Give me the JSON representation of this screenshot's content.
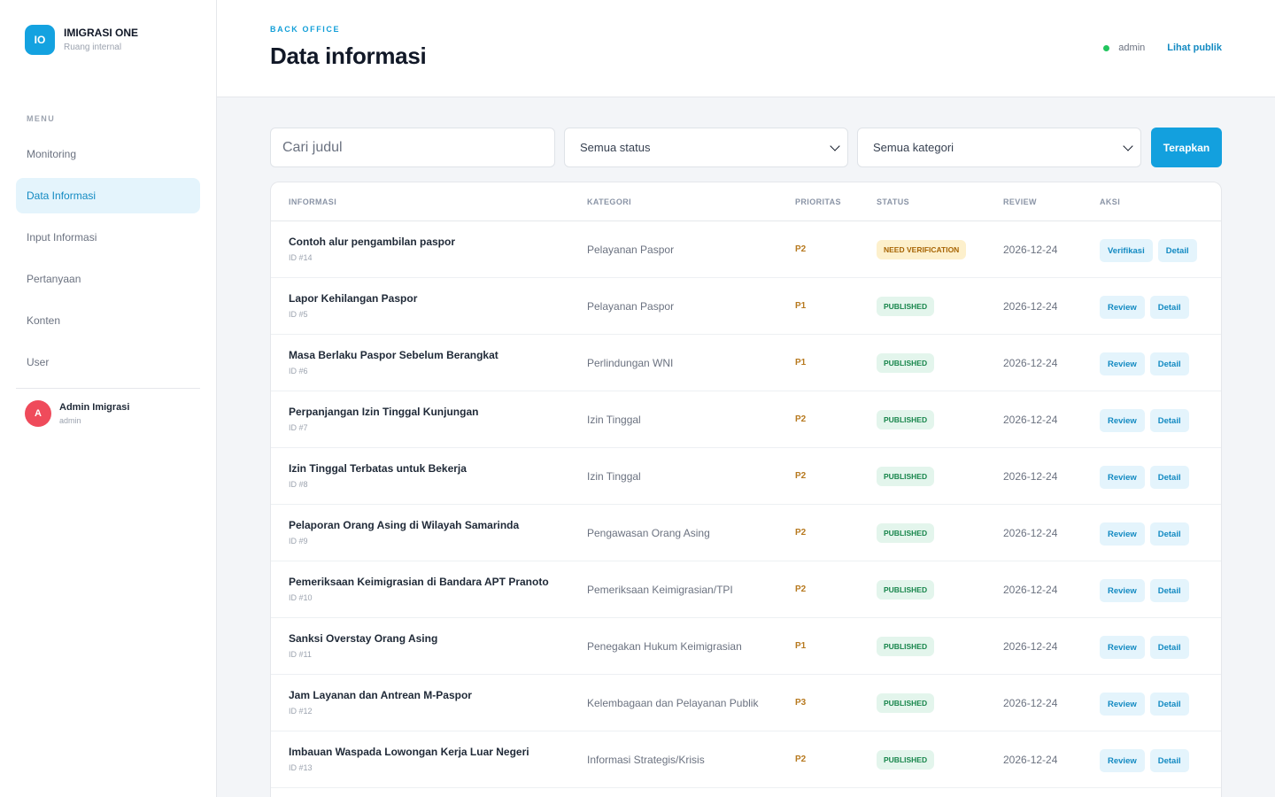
{
  "brand": {
    "logo": "IO",
    "name": "IMIGRASI ONE",
    "subtitle": "Ruang internal"
  },
  "sidebar": {
    "menu_heading": "MENU",
    "items": [
      {
        "label": "Monitoring"
      },
      {
        "label": "Data Informasi"
      },
      {
        "label": "Input Informasi"
      },
      {
        "label": "Pertanyaan"
      },
      {
        "label": "Konten"
      },
      {
        "label": "User"
      }
    ],
    "active_index": 1,
    "user": {
      "initial": "A",
      "name": "Admin Imigrasi",
      "role": "admin"
    }
  },
  "header": {
    "eyebrow": "BACK OFFICE",
    "title": "Data informasi",
    "user": "admin",
    "public_link": "Lihat publik"
  },
  "filters": {
    "search_placeholder": "Cari judul",
    "status_selected": "Semua status",
    "category_selected": "Semua kategori",
    "apply_label": "Terapkan"
  },
  "table": {
    "headers": [
      "INFORMASI",
      "KATEGORI",
      "PRIORITAS",
      "STATUS",
      "REVIEW",
      "AKSI"
    ],
    "rows": [
      {
        "title": "Contoh alur pengambilan paspor",
        "id": "ID #14",
        "category": "Pelayanan Paspor",
        "priority": "P2",
        "status": "NEED VERIFICATION",
        "review": "2026-12-24",
        "action": "Verifikasi",
        "detail": "Detail"
      },
      {
        "title": "Lapor Kehilangan Paspor",
        "id": "ID #5",
        "category": "Pelayanan Paspor",
        "priority": "P1",
        "status": "PUBLISHED",
        "review": "2026-12-24",
        "action": "Review",
        "detail": "Detail"
      },
      {
        "title": "Masa Berlaku Paspor Sebelum Berangkat",
        "id": "ID #6",
        "category": "Perlindungan WNI",
        "priority": "P1",
        "status": "PUBLISHED",
        "review": "2026-12-24",
        "action": "Review",
        "detail": "Detail"
      },
      {
        "title": "Perpanjangan Izin Tinggal Kunjungan",
        "id": "ID #7",
        "category": "Izin Tinggal",
        "priority": "P2",
        "status": "PUBLISHED",
        "review": "2026-12-24",
        "action": "Review",
        "detail": "Detail"
      },
      {
        "title": "Izin Tinggal Terbatas untuk Bekerja",
        "id": "ID #8",
        "category": "Izin Tinggal",
        "priority": "P2",
        "status": "PUBLISHED",
        "review": "2026-12-24",
        "action": "Review",
        "detail": "Detail"
      },
      {
        "title": "Pelaporan Orang Asing di Wilayah Samarinda",
        "id": "ID #9",
        "category": "Pengawasan Orang Asing",
        "priority": "P2",
        "status": "PUBLISHED",
        "review": "2026-12-24",
        "action": "Review",
        "detail": "Detail"
      },
      {
        "title": "Pemeriksaan Keimigrasian di Bandara APT Pranoto",
        "id": "ID #10",
        "category": "Pemeriksaan Keimigrasian/TPI",
        "priority": "P2",
        "status": "PUBLISHED",
        "review": "2026-12-24",
        "action": "Review",
        "detail": "Detail"
      },
      {
        "title": "Sanksi Overstay Orang Asing",
        "id": "ID #11",
        "category": "Penegakan Hukum Keimigrasian",
        "priority": "P1",
        "status": "PUBLISHED",
        "review": "2026-12-24",
        "action": "Review",
        "detail": "Detail"
      },
      {
        "title": "Jam Layanan dan Antrean M-Paspor",
        "id": "ID #12",
        "category": "Kelembagaan dan Pelayanan Publik",
        "priority": "P3",
        "status": "PUBLISHED",
        "review": "2026-12-24",
        "action": "Review",
        "detail": "Detail"
      },
      {
        "title": "Imbauan Waspada Lowongan Kerja Luar Negeri",
        "id": "ID #13",
        "category": "Informasi Strategis/Krisis",
        "priority": "P2",
        "status": "PUBLISHED",
        "review": "2026-12-24",
        "action": "Review",
        "detail": "Detail"
      }
    ]
  },
  "colors": {
    "accent": "#13a0de",
    "active_bg": "#e4f4fc",
    "online": "#22c55e",
    "avatar": "#ef4b5b",
    "priority": "#b7791f"
  }
}
